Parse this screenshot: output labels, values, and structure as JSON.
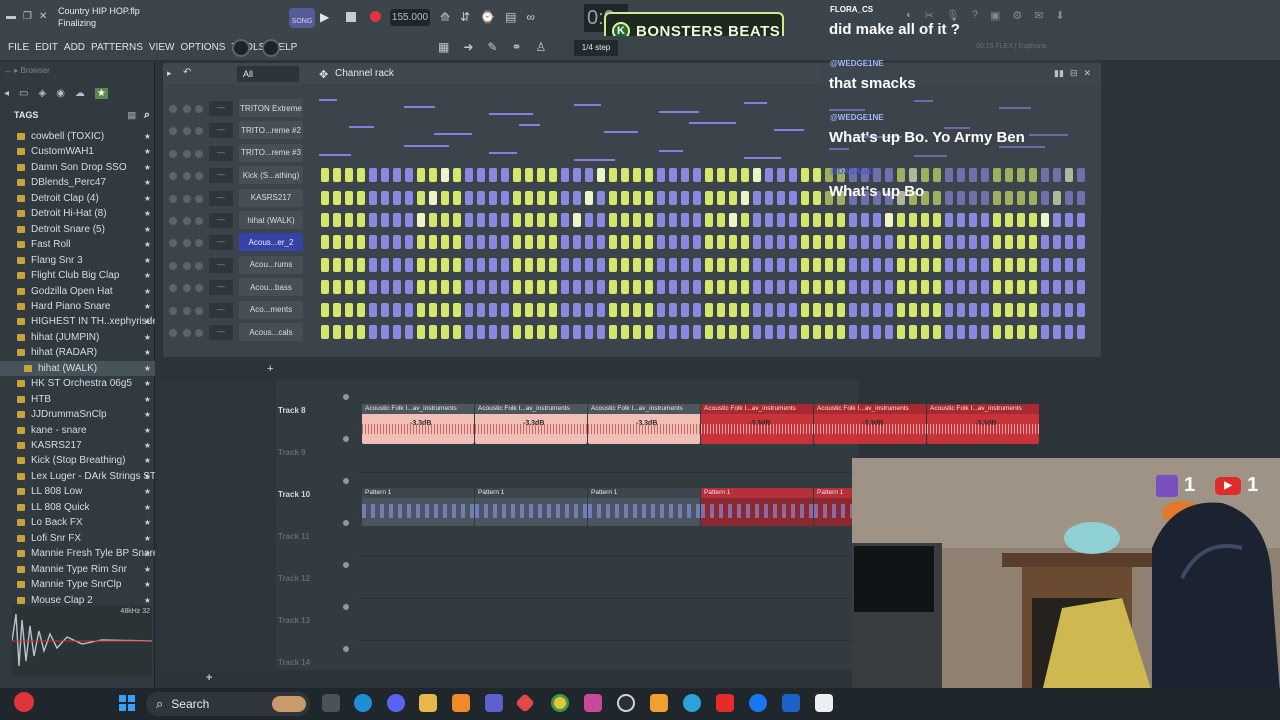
{
  "title": {
    "project_file": "Country HIP HOP.flp",
    "status": "Finalizing",
    "tempo": "155.000",
    "snap": "1/4 step",
    "hint": "05:15 FLEX | Euphoria"
  },
  "menu": [
    "FILE",
    "EDIT",
    "ADD",
    "PATTERNS",
    "VIEW",
    "OPTIONS",
    "TOOLS",
    "HELP"
  ],
  "logo_text": "BONSTERS BEATS",
  "browser": {
    "header": "Browser",
    "tags_label": "TAGS",
    "items": [
      "cowbell (TOXIC)",
      "CustomWAH1",
      "Damn Son Drop SSO",
      "DBlends_Perc47",
      "Detroit Clap (4)",
      "Detroit Hi-Hat (8)",
      "Detroit Snare (5)",
      "Fast Roll",
      "Flang Snr 3",
      "Flight Club Big Clap",
      "Godzilla Open Hat",
      "Hard Piano Snare",
      "HIGHEST IN TH..xephyrisdead)",
      "hihat (JUMPIN)",
      "hihat (RADAR)",
      "hihat (WALK)",
      "HK ST Orchestra 06g5",
      "HTB",
      "JJDrummaSnClp",
      "kane - snare",
      "KASRS217",
      "Kick (Stop Breathing)",
      "Lex Luger - DArk Strings STC",
      "LL 808 Low",
      "LL 808 Quick",
      "Lo Back FX",
      "Lofi Snr FX",
      "Mannie Fresh Tyle BP Snare",
      "Mannie Type Rim Snr",
      "Mannie Type SnrClp",
      "Mouse Clap 2"
    ],
    "selected_index": 15,
    "sample_info": "48kHz 32"
  },
  "rack": {
    "filter": "All",
    "title": "Channel rack",
    "channels": [
      {
        "name": "TRITON Extreme",
        "kind": "piano"
      },
      {
        "name": "TRITO...reme #2",
        "kind": "piano"
      },
      {
        "name": "TRITO...reme #3",
        "kind": "piano"
      },
      {
        "name": "Kick (S...athing)",
        "kind": "steps"
      },
      {
        "name": "KASRS217",
        "kind": "steps"
      },
      {
        "name": "hihat (WALK)",
        "kind": "steps"
      },
      {
        "name": "Acous...er_2",
        "kind": "steps",
        "selected": true
      },
      {
        "name": "Acou...rums",
        "kind": "steps"
      },
      {
        "name": "Acou...bass",
        "kind": "steps"
      },
      {
        "name": "Aco...ments",
        "kind": "steps"
      },
      {
        "name": "Acous...cals",
        "kind": "steps"
      }
    ]
  },
  "playlist": {
    "tracks": [
      {
        "label": "Track 8",
        "dim": false
      },
      {
        "label": "Track 9",
        "dim": true
      },
      {
        "label": "Track 10",
        "dim": false
      },
      {
        "label": "Track 11",
        "dim": true
      },
      {
        "label": "Track 12",
        "dim": true
      },
      {
        "label": "Track 13",
        "dim": true
      },
      {
        "label": "Track 14",
        "dim": true
      }
    ],
    "audio_clip_label": "Acoustic Folk I...av_instruments",
    "clip_db": "-3.3dB",
    "pattern_clip_label": "Pattern 1"
  },
  "chat": {
    "messages": [
      {
        "user": "FLORA_CS",
        "text": "did make all of it ?",
        "user_color": "#ffffff"
      },
      {
        "user": "@WEDGE1NE",
        "text": "that smacks",
        "user_color": "#9fb6ff"
      },
      {
        "user": "@WEDGE1NE",
        "text": "What's up Bo. Yo Army Ben",
        "user_color": "#9fb6ff"
      },
      {
        "user": "@DABASKI",
        "text": "What's up Bo",
        "user_color": "#4a55d8"
      }
    ]
  },
  "stream": {
    "twitch_count": "1",
    "youtube_count": "1"
  },
  "taskbar": {
    "search_label": "Search"
  },
  "colors": {
    "step_on": "#d6e66a",
    "step_off": "#8a88e0",
    "step_bright": "#eef4c6",
    "selected_channel": "#3542a8",
    "audio_clip": "#f0c0b8",
    "audio_clip_red": "#c8333a",
    "pattern_clip": "#4a5560",
    "accent_red": "#c8333a"
  }
}
